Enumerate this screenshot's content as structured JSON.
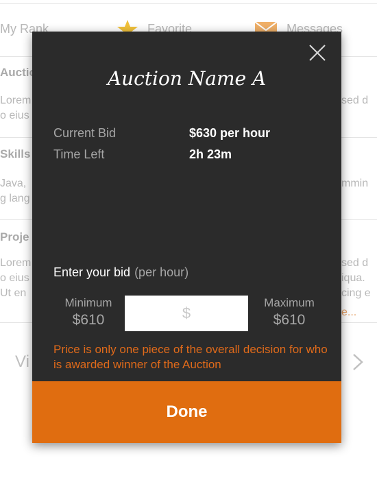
{
  "background": {
    "tabs": [
      {
        "label": "My Rank",
        "icon": "rank-icon"
      },
      {
        "label": "Favorite",
        "icon": "star-icon",
        "icon_color": "#f2c23a"
      },
      {
        "label": "Messages",
        "icon": "envelope-icon",
        "icon_color": "#f0b068"
      }
    ],
    "sections": [
      {
        "title": "Auctio",
        "lines": [
          "Lorem",
          "o eius"
        ],
        "right_lines": [
          "sed d"
        ]
      },
      {
        "title": "Skills",
        "lines": [
          "Java,",
          "g lang"
        ],
        "right_lines": [
          "mmin"
        ]
      },
      {
        "title": "Proje",
        "lines": [
          "Lorem",
          "o eius",
          "Ut en"
        ],
        "right_lines": [
          "sed d",
          "iqua.",
          "cing e"
        ],
        "more": "e..."
      }
    ],
    "view_all_label": "Vi",
    "chevron_icon": "chevron-right-icon"
  },
  "modal": {
    "close_icon": "close-icon",
    "title": "Auction Name A",
    "current_bid_label": "Current Bid",
    "current_bid_value": "$630 per hour",
    "time_left_label": "Time Left",
    "time_left_value": "2h 23m",
    "bid_prompt": "Enter your bid",
    "bid_prompt_unit": "(per hour)",
    "minimum_label": "Minimum",
    "minimum_value": "$610",
    "maximum_label": "Maximum",
    "maximum_value": "$610",
    "bid_input_placeholder": "$",
    "bid_input_value": "",
    "warning_text": "Price is only one piece of the overall decision for who is awarded winner of the Auction",
    "done_label": "Done"
  },
  "colors": {
    "modal_background": "#2b2b2b",
    "accent": "#e06d10",
    "warning": "#e06a1a"
  }
}
